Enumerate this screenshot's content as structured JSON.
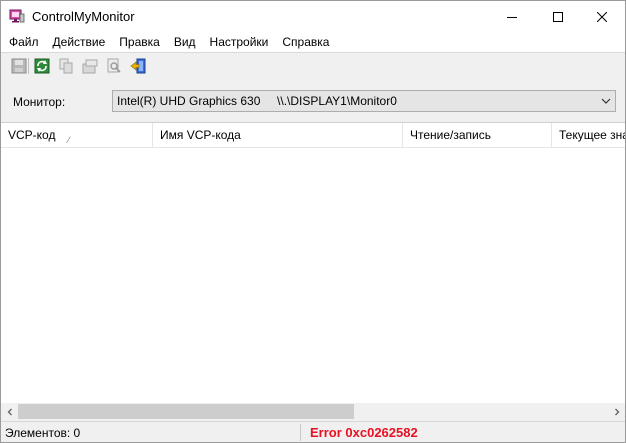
{
  "window": {
    "title": "ControlMyMonitor"
  },
  "menu": {
    "items": [
      {
        "label": "Файл"
      },
      {
        "label": "Действие"
      },
      {
        "label": "Правка"
      },
      {
        "label": "Вид"
      },
      {
        "label": "Настройки"
      },
      {
        "label": "Справка"
      }
    ]
  },
  "toolbar": {
    "buttons": [
      {
        "icon": "save-icon",
        "enabled": false
      },
      {
        "icon": "refresh-icon",
        "enabled": true
      },
      {
        "icon": "copy-icon",
        "enabled": false
      },
      {
        "icon": "properties-icon",
        "enabled": false
      },
      {
        "icon": "find-icon",
        "enabled": false
      },
      {
        "icon": "exit-icon",
        "enabled": true
      }
    ]
  },
  "monitor": {
    "label": "Монитор:",
    "selected": "Intel(R) UHD Graphics 630     \\\\.\\DISPLAY1\\Monitor0"
  },
  "list": {
    "columns": [
      {
        "label": "VCP-код",
        "sorted": true
      },
      {
        "label": "Имя VCP-кода"
      },
      {
        "label": "Чтение/запись"
      },
      {
        "label": "Текущее зна"
      }
    ],
    "rows": []
  },
  "status": {
    "count": "Элементов: 0",
    "error": "Error 0xc0262582",
    "error_color": "#e81123"
  }
}
